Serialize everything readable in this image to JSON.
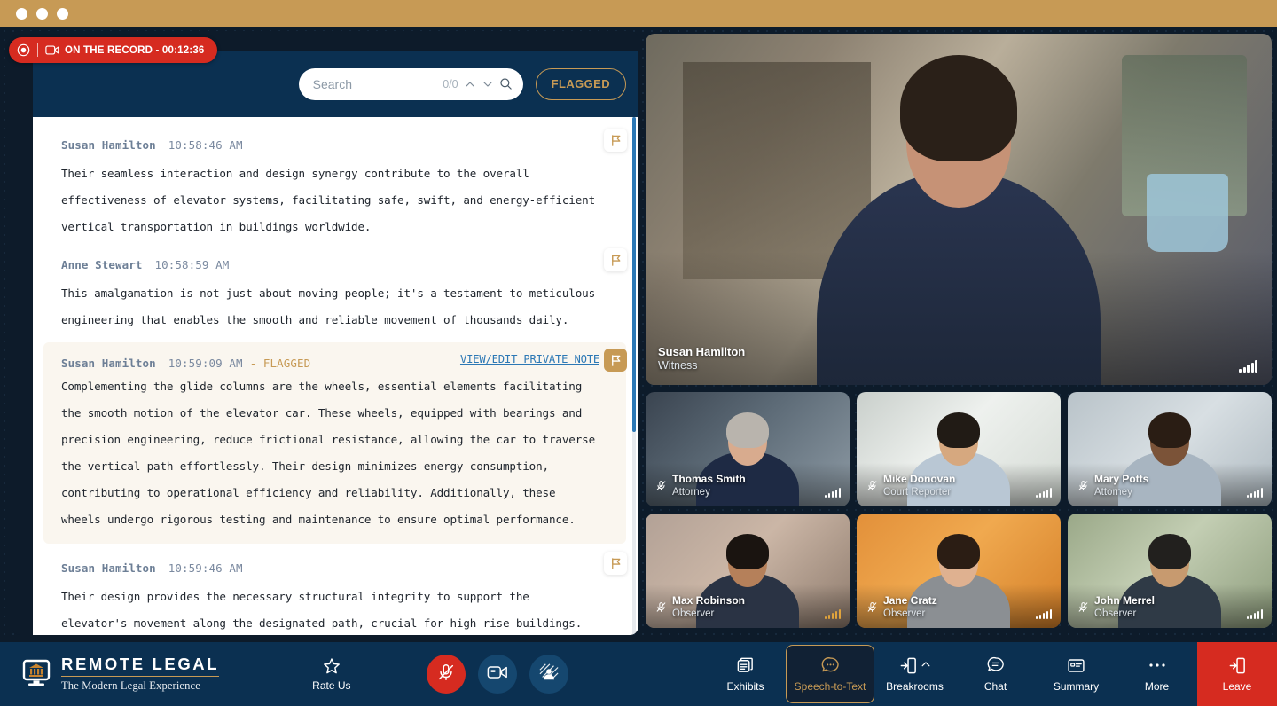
{
  "titlebar": {
    "dots": 3
  },
  "record": {
    "label": "ON THE RECORD - 00:12:36",
    "record_icon": "record-dot-icon",
    "camera_icon": "video-camera-icon",
    "color": "#d62b20"
  },
  "search": {
    "placeholder": "Search",
    "value": "",
    "count": "0/0",
    "up_icon": "chevron-up-icon",
    "down_icon": "chevron-down-icon",
    "search_icon": "magnifier-icon"
  },
  "flagged_button": {
    "label": "FLAGGED",
    "color": "#c79a55"
  },
  "transcript": {
    "scroll_thumb_color": "#2c78b5",
    "private_note_label": "VIEW/EDIT PRIVATE NOTE",
    "flag_icon": "flag-icon",
    "entries": [
      {
        "speaker": "Susan Hamilton",
        "time": "10:58:46 AM",
        "flag_suffix": "",
        "flagged": false,
        "text": "Their seamless interaction and design synergy contribute to the overall\neffectiveness of elevator systems, facilitating safe, swift, and energy-efficient\nvertical transportation in buildings worldwide."
      },
      {
        "speaker": "Anne Stewart",
        "time": "10:58:59 AM",
        "flag_suffix": "",
        "flagged": false,
        "text": "This amalgamation is not just about moving people; it's a testament to meticulous\nengineering that enables the smooth and reliable movement of thousands daily."
      },
      {
        "speaker": "Susan Hamilton",
        "time": "10:59:09 AM",
        "flag_suffix": "- FLAGGED",
        "flagged": true,
        "text": "Complementing the glide columns are the wheels, essential elements facilitating\nthe smooth motion of the elevator car. These wheels, equipped with bearings and\nprecision engineering, reduce frictional resistance, allowing the car to traverse\nthe vertical path effortlessly. Their design minimizes energy consumption,\ncontributing to operational efficiency and reliability. Additionally, these\nwheels undergo rigorous testing and maintenance to ensure optimal performance."
      },
      {
        "speaker": "Susan Hamilton",
        "time": "10:59:46 AM",
        "flag_suffix": "",
        "flagged": false,
        "text": "Their design provides the necessary structural integrity to support the\nelevator's movement along the designated path, crucial for high-rise buildings."
      }
    ]
  },
  "video": {
    "main": {
      "name": "Susan Hamilton",
      "role": "Witness",
      "muted": false,
      "signal": "signal-bars-icon"
    },
    "participants": [
      {
        "name": "Thomas Smith",
        "role": "Attorney",
        "muted": true,
        "signal": "signal-bars-icon"
      },
      {
        "name": "Mike Donovan",
        "role": "Court Reporter",
        "muted": true,
        "signal": "signal-bars-icon"
      },
      {
        "name": "Mary Potts",
        "role": "Attorney",
        "muted": true,
        "signal": "signal-bars-icon"
      },
      {
        "name": "Max Robinson",
        "role": "Observer",
        "muted": true,
        "signal": "signal-bars-amber-icon"
      },
      {
        "name": "Jane Cratz",
        "role": "Observer",
        "muted": true,
        "signal": "signal-bars-icon"
      },
      {
        "name": "John Merrel",
        "role": "Observer",
        "muted": true,
        "signal": "signal-bars-icon"
      }
    ]
  },
  "toolbar": {
    "logo": {
      "title": "REMOTE LEGAL",
      "subtitle": "The Modern Legal Experience",
      "icon": "courthouse-monitor-icon"
    },
    "rate_us": {
      "label": "Rate Us",
      "icon": "star-icon"
    },
    "round_buttons": [
      {
        "name": "microphone-muted-button",
        "icon": "mic-off-icon",
        "state": "muted",
        "color": "#d62b20"
      },
      {
        "name": "camera-button",
        "icon": "video-camera-icon",
        "state": "on",
        "color": "#15476f"
      },
      {
        "name": "share-screen-button",
        "icon": "screen-share-icon",
        "state": "on",
        "color": "#15476f"
      }
    ],
    "items": [
      {
        "label": "Exhibits",
        "icon": "exhibits-icon",
        "active": false
      },
      {
        "label": "Speech-to-Text",
        "icon": "speech-bubble-icon",
        "active": true
      },
      {
        "label": "Breakrooms",
        "icon": "door-exit-icon",
        "active": false,
        "caret": "chevron-up-icon"
      },
      {
        "label": "Chat",
        "icon": "chat-bubble-icon",
        "active": false
      },
      {
        "label": "Summary",
        "icon": "summary-card-icon",
        "active": false
      },
      {
        "label": "More",
        "icon": "ellipsis-icon",
        "active": false
      },
      {
        "label": "Leave",
        "icon": "door-exit-icon",
        "active": false,
        "danger": true
      }
    ]
  }
}
